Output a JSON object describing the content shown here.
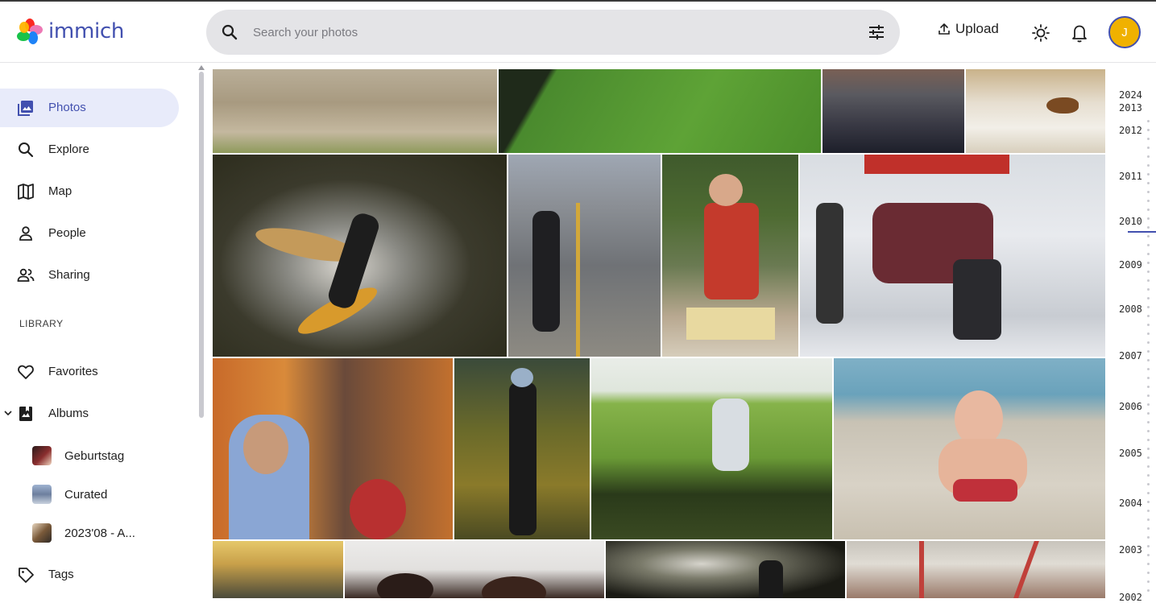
{
  "app": {
    "logo_text": "immich",
    "brand_color": "#4250af"
  },
  "search": {
    "placeholder": "Search your photos",
    "value": ""
  },
  "header": {
    "upload_label": "Upload",
    "avatar_initial": "J",
    "avatar_color": "#f0b100"
  },
  "sidebar": {
    "items": [
      {
        "label": "Photos",
        "icon": "photos-icon",
        "active": true
      },
      {
        "label": "Explore",
        "icon": "search-icon"
      },
      {
        "label": "Map",
        "icon": "map-icon"
      },
      {
        "label": "People",
        "icon": "person-icon"
      },
      {
        "label": "Sharing",
        "icon": "sharing-icon"
      }
    ],
    "library_label": "LIBRARY",
    "library_items": [
      {
        "label": "Favorites",
        "icon": "heart-icon"
      },
      {
        "label": "Albums",
        "icon": "album-icon",
        "expanded": true
      },
      {
        "label": "Tags",
        "icon": "tag-icon"
      }
    ],
    "albums": [
      {
        "label": "Geburtstag"
      },
      {
        "label": "Curated"
      },
      {
        "label": "2023'08 - A..."
      }
    ]
  },
  "timeline": {
    "years": [
      "2024",
      "2013",
      "2012",
      "2011",
      "2010",
      "2009",
      "2008",
      "2007",
      "2006",
      "2005",
      "2004",
      "2003",
      "2002"
    ],
    "current": "2010"
  },
  "photos": [
    {
      "name": "sand-ground"
    },
    {
      "name": "bird-on-grass"
    },
    {
      "name": "rooftop-city"
    },
    {
      "name": "fox-in-snow"
    },
    {
      "name": "surfer-splash"
    },
    {
      "name": "woman-on-road"
    },
    {
      "name": "cheese-vendor"
    },
    {
      "name": "ice-hockey"
    },
    {
      "name": "crowd-festival"
    },
    {
      "name": "climbing-park"
    },
    {
      "name": "boy-in-field"
    },
    {
      "name": "child-on-beach"
    },
    {
      "name": "stadium-crowd"
    },
    {
      "name": "portrait-dark"
    },
    {
      "name": "splash-figure"
    },
    {
      "name": "hall-interior"
    }
  ]
}
